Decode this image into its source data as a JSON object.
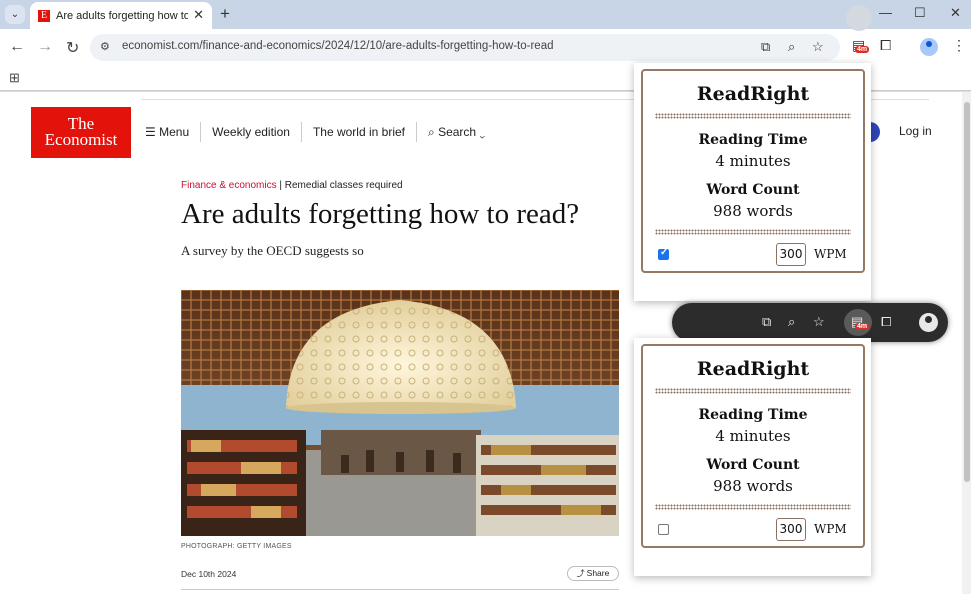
{
  "browser": {
    "tab_title": "Are adults forgetting how to read",
    "favicon_letter": "E",
    "url": "economist.com/finance-and-economics/2024/12/10/are-adults-forgetting-how-to-read",
    "extension_badge": "4m",
    "icons": {
      "tab_search": "chevron-down-icon",
      "back": "back-arrow-icon",
      "forward": "forward-arrow-icon",
      "reload": "reload-icon",
      "site_info": "tune-icon",
      "install": "install-app-icon",
      "zoom": "zoom-icon",
      "bookmark": "star-icon",
      "extensions": "puzzle-icon",
      "profile": "avatar-icon",
      "menu": "kebab-menu-icon",
      "apps": "apps-grid-icon"
    }
  },
  "site": {
    "logo_line1": "The",
    "logo_line2": "Economist",
    "nav": {
      "menu": "Menu",
      "weekly": "Weekly edition",
      "world": "The world in brief",
      "search": "Search"
    },
    "login": "Log in"
  },
  "article": {
    "section": "Finance & economics",
    "separator": " | ",
    "kicker": "Remedial classes required",
    "headline": "Are adults forgetting how to read?",
    "standfirst": "A survey by the OECD suggests so",
    "caption": "PHOTOGRAPH: GETTY IMAGES",
    "date": "Dec 10th 2024",
    "share": "Share"
  },
  "popups": [
    {
      "title": "ReadRight",
      "reading_time_label": "Reading Time",
      "reading_time_value": "4 minutes",
      "word_count_label": "Word Count",
      "word_count_value": "988 words",
      "checked": true,
      "wpm_value": "300",
      "wpm_unit": "WPM"
    },
    {
      "title": "ReadRight",
      "reading_time_label": "Reading Time",
      "reading_time_value": "4 minutes",
      "word_count_label": "Word Count",
      "word_count_value": "988 words",
      "checked": false,
      "wpm_value": "300",
      "wpm_unit": "WPM"
    }
  ],
  "colors": {
    "economist_red": "#e3120b",
    "popup_border": "#967964",
    "section_red": "#c8102e"
  }
}
